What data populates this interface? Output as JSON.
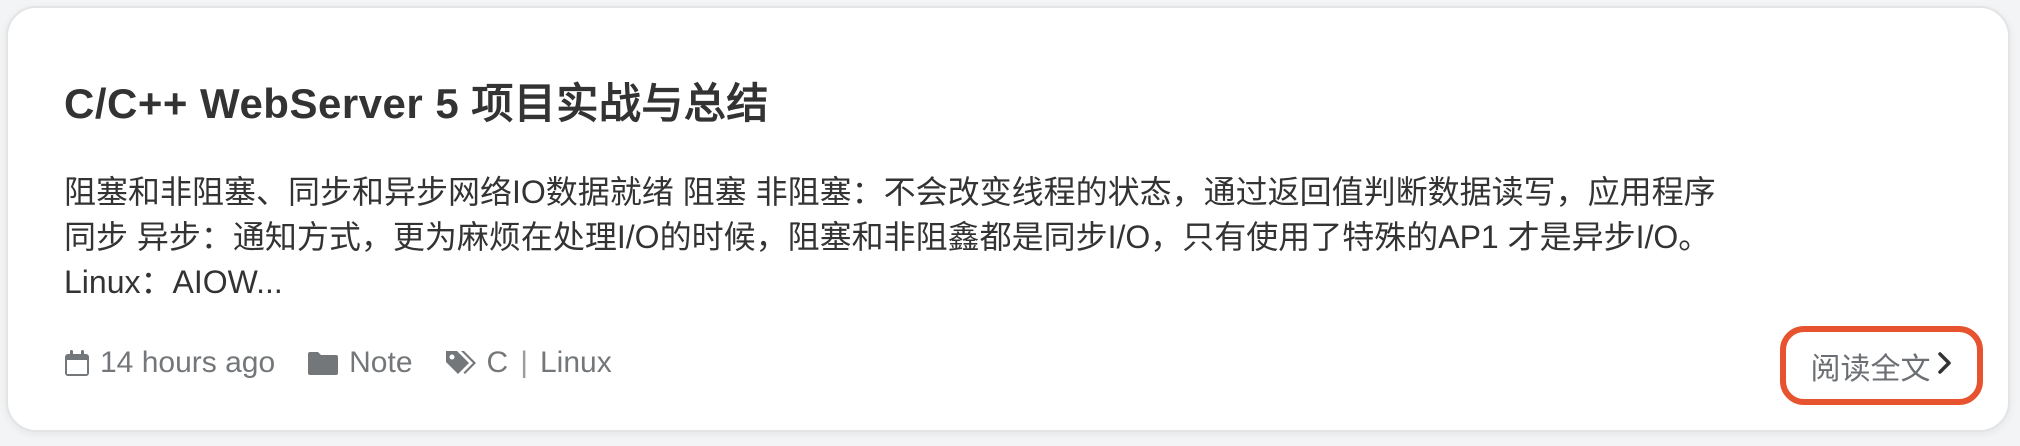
{
  "post": {
    "title": "C/C++ WebServer 5 项目实战与总结",
    "excerpt_lines": [
      "阻塞和非阻塞、同步和异步网络IO数据就绪 阻塞 非阻塞：不会改变线程的状态，通过返回值判断数据读写，应用程序",
      "同步 异步：通知方式，更为麻烦在处理I/O的时候，阻塞和非阻鑫都是同步I/O，只有使用了特殊的AP1 才是异步I/O。",
      "Linux：AIOW..."
    ],
    "meta": {
      "date_icon": "calendar-icon",
      "date": "14 hours ago",
      "category_icon": "folder-icon",
      "category": "Note",
      "tags_icon": "tags-icon",
      "tags": [
        "C",
        "Linux"
      ],
      "tag_separator": "|"
    },
    "read_more": {
      "label": "阅读全文",
      "icon": "chevron-right-icon",
      "highlight_color": "#e8532f"
    }
  }
}
